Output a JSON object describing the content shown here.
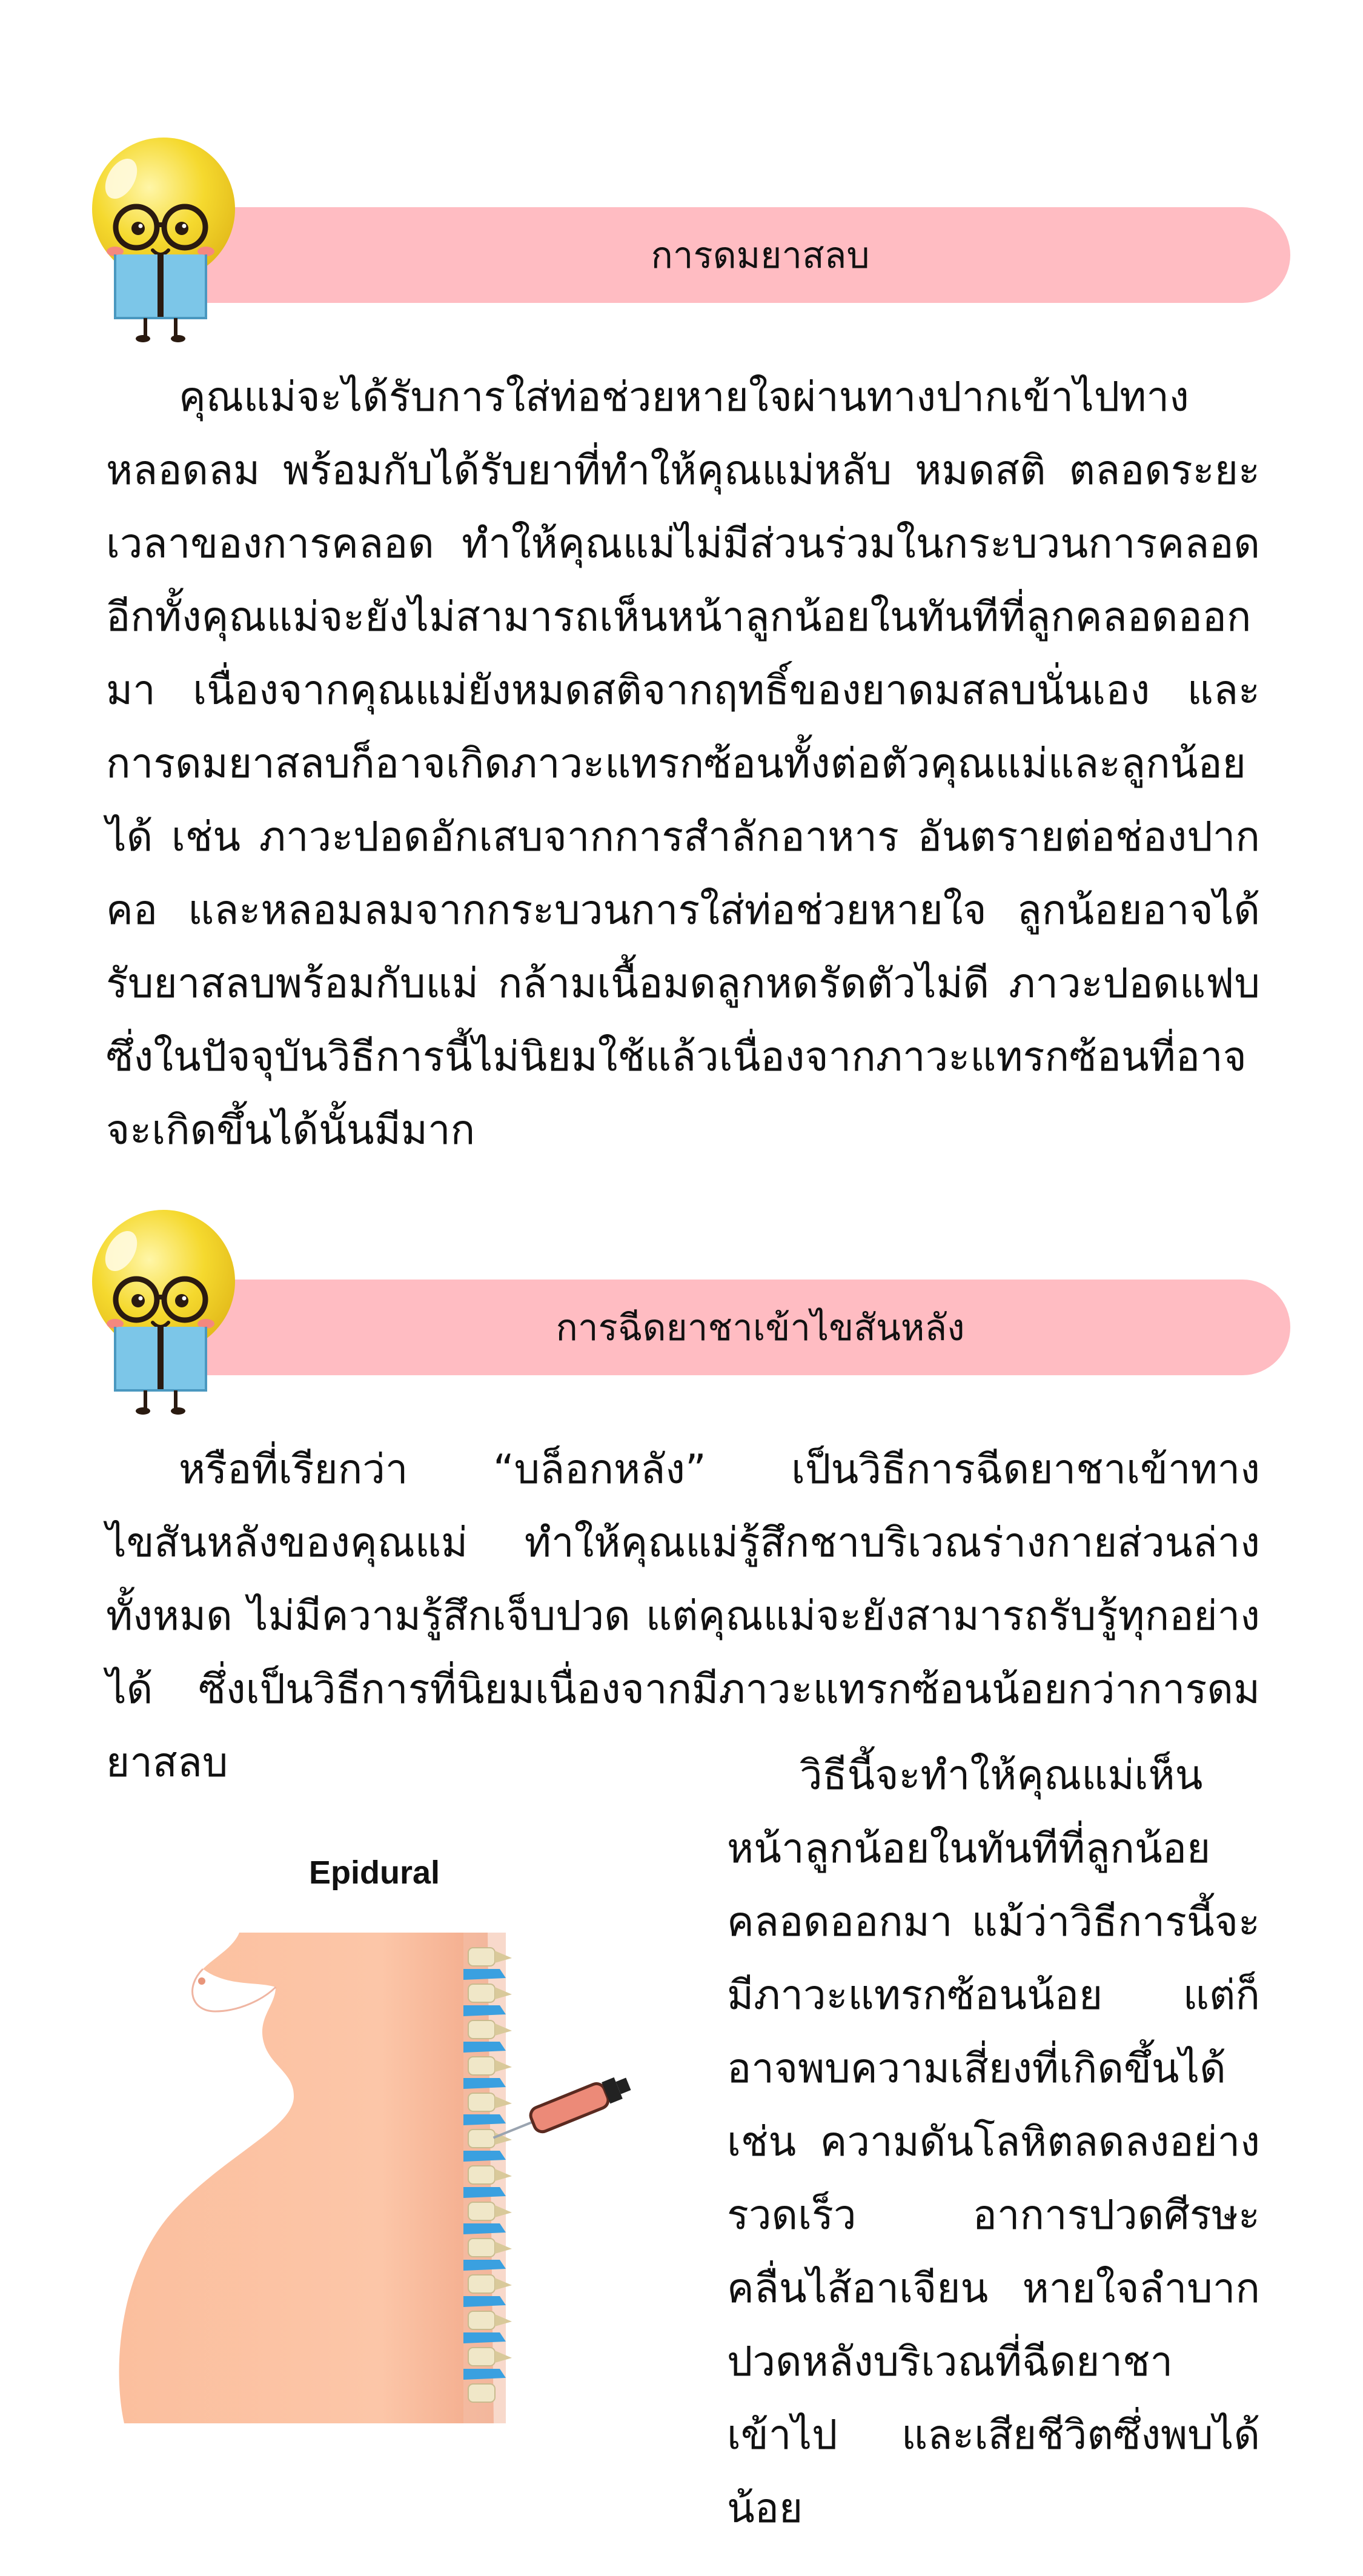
{
  "section1": {
    "title": "การดมยาสลบ",
    "body": "คุณแม่จะได้รับการใส่ท่อช่วยหายใจผ่านทางปากเข้าไปทางหลอดลม พร้อมกับได้รับยาที่ทำให้คุณแม่หลับ หมดสติ ตลอดระยะเวลาของการคลอด ทำให้คุณแม่ไม่มีส่วนร่วมในกระบวนการคลอด อีกทั้งคุณแม่จะยังไม่สามารถเห็นหน้าลูกน้อยในทันทีที่ลูกคลอดออกมา เนื่องจากคุณแม่ยังหมดสติจากฤทธิ์ของยาดมสลบนั่นเอง และการดมยาสลบก็อาจเกิดภาวะแทรกซ้อนทั้งต่อตัวคุณแม่และลูกน้อยได้ เช่น ภาวะปอดอักเสบจากการสำลักอาหาร อันตรายต่อช่องปาก คอ และหลอมลมจากกระบวนการใส่ท่อช่วยหายใจ ลูกน้อยอาจได้รับยาสลบพร้อมกับแม่ กล้ามเนื้อมดลูกหดรัดตัวไม่ดี ภาวะปอดแฟบ ซึ่งในปัจจุบันวิธีการนี้ไม่นิยมใช้แล้วเนื่องจากภาวะแทรกซ้อนที่อาจจะเกิดขึ้นได้นั้นมีมาก"
  },
  "section2": {
    "title": "การฉีดยาชาเข้าไขสันหลัง",
    "body": "หรือที่เรียกว่า “บล็อกหลัง” เป็นวิธีการฉีดยาชาเข้าทางไขสันหลังของคุณแม่ ทำให้คุณแม่รู้สึกชาบริเวณร่างกายส่วนล่างทั้งหมด ไม่มีความรู้สึกเจ็บปวด แต่คุณแม่จะยังสามารถรับรู้ทุกอย่างได้ ซึ่งเป็นวิธีการที่นิยมเนื่องจากมีภาวะแทรกซ้อนน้อยกว่าการดมยาสลบ",
    "body_right": "วิธีนี้จะทำให้คุณแม่เห็นหน้าลูกน้อยในทันทีที่ลูกน้อยคลอดออกมา แม้ว่าวิธีการนี้จะมีภาวะแทรกซ้อนน้อย แต่ก็อาจพบความเสี่ยงที่เกิดขึ้นได้ เช่น ความดันโลหิตลดลงอย่างรวดเร็ว อาการปวดศีรษะ คลื่นไส้อาเจียน หายใจลำบาก ปวดหลังบริเวณที่ฉีดยาชาเข้าไป และเสียชีวิตซึ่งพบได้น้อย"
  },
  "figure": {
    "title": "Epidural"
  },
  "colors": {
    "pill": "#ffbcc2",
    "skin": "#fcc3a4",
    "mascot_bulb": "#f5d92e",
    "mascot_book": "#7cc6e8"
  }
}
